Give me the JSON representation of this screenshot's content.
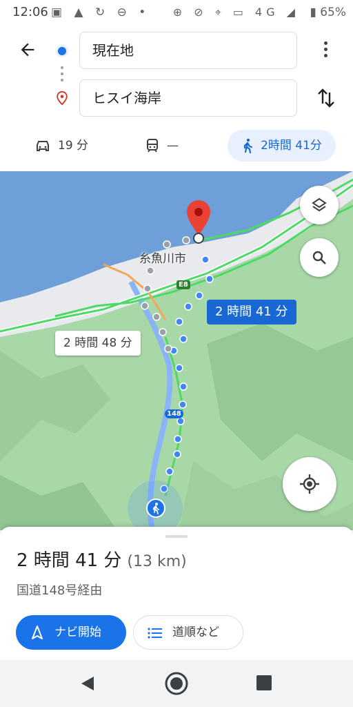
{
  "status_bar": {
    "time": "12:06",
    "left_icons": "▣ ▲ ↻ ⊖ •",
    "right_icons": "⊕ ⊘ ⌖ ▭ 4G ◢",
    "battery": "▮ 65%"
  },
  "route": {
    "origin": "現在地",
    "destination": "ヒスイ海岸"
  },
  "modes": {
    "drive": "19 分",
    "transit": "—",
    "walk": "2時間 41分"
  },
  "map": {
    "city_label": "糸魚川市",
    "expressway_label": "E8",
    "route_label": "148",
    "primary_route_time": "2 時間 41 分",
    "alt_route_time": "2 時間 48 分"
  },
  "sheet": {
    "duration": "2 時間 41 分",
    "distance": "(13 km)",
    "via": "国道148号経由",
    "start_label": "ナビ開始",
    "steps_label": "道順など"
  },
  "colors": {
    "accent": "#1a73e8",
    "sea": "#6f9fd8",
    "land": "#a8d8a8",
    "pin": "#d93025"
  }
}
